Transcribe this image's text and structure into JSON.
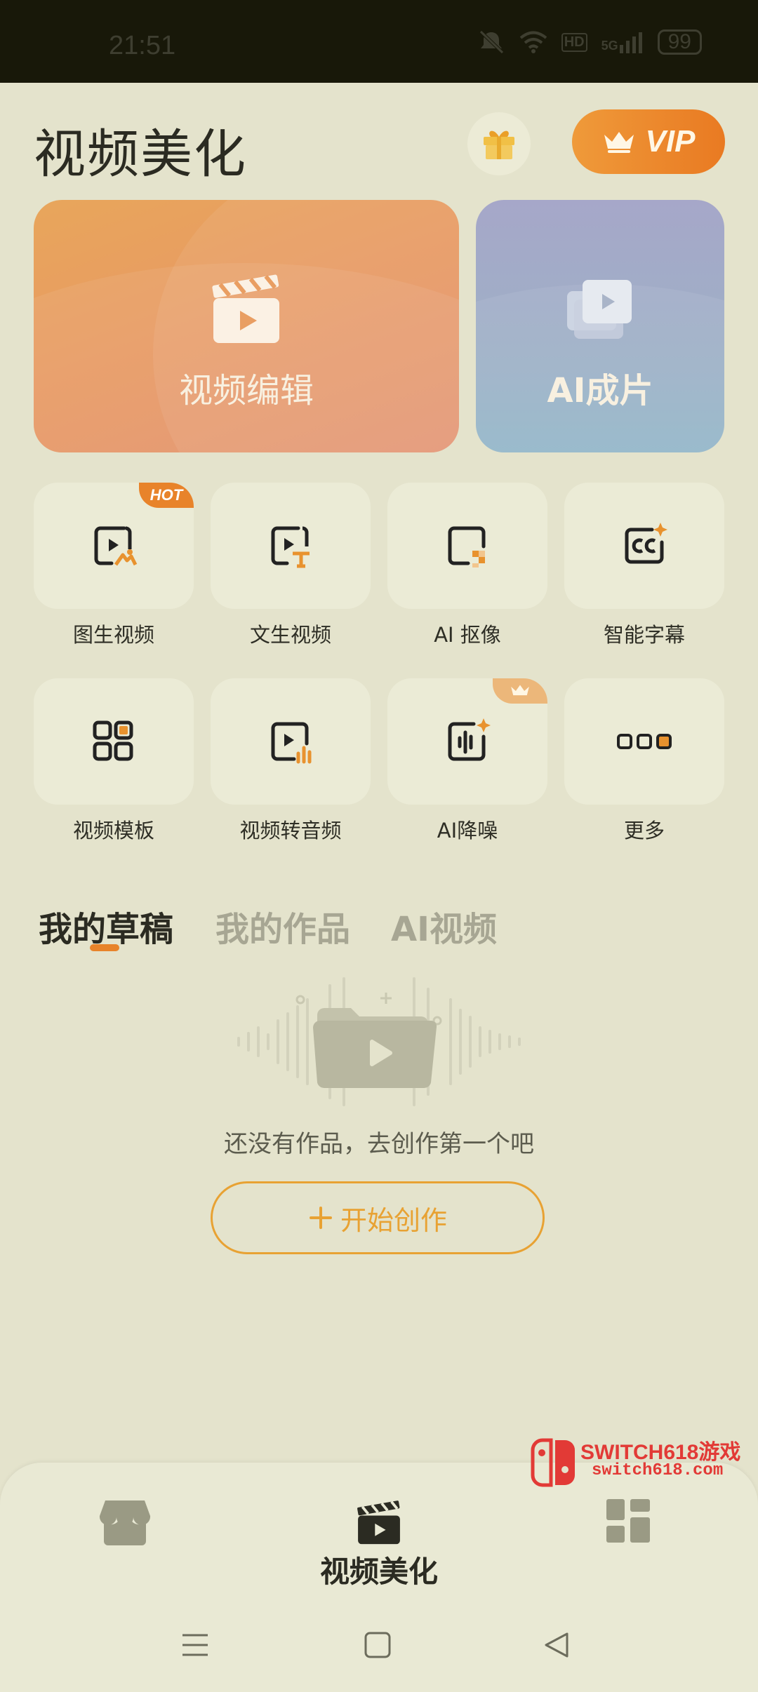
{
  "status_bar": {
    "time": "21:51",
    "network": "5G",
    "hd": "HD",
    "battery": "99"
  },
  "header": {
    "title": "视频美化",
    "vip_label": "VIP"
  },
  "cards": {
    "edit_label": "视频编辑",
    "ai_label": "AI成片"
  },
  "tools": [
    {
      "label": "图生视频",
      "badge": "HOT"
    },
    {
      "label": "文生视频"
    },
    {
      "label": "AI 抠像"
    },
    {
      "label": "智能字幕"
    },
    {
      "label": "视频模板"
    },
    {
      "label": "视频转音频"
    },
    {
      "label": "AI降噪"
    },
    {
      "label": "更多"
    }
  ],
  "tabs": {
    "drafts": "我的草稿",
    "works": "我的作品",
    "ai": "AI视频",
    "active": "drafts"
  },
  "empty_state": {
    "message": "还没有作品，去创作第一个吧",
    "button_label": "开始创作"
  },
  "watermark": {
    "title": "SWITCH618游戏",
    "url": "switch618.com"
  },
  "bottom_nav": {
    "active_label": "视频美化"
  },
  "colors": {
    "accent": "#e8832a",
    "button_border": "#e8a233",
    "background": "#e4e3cc"
  }
}
